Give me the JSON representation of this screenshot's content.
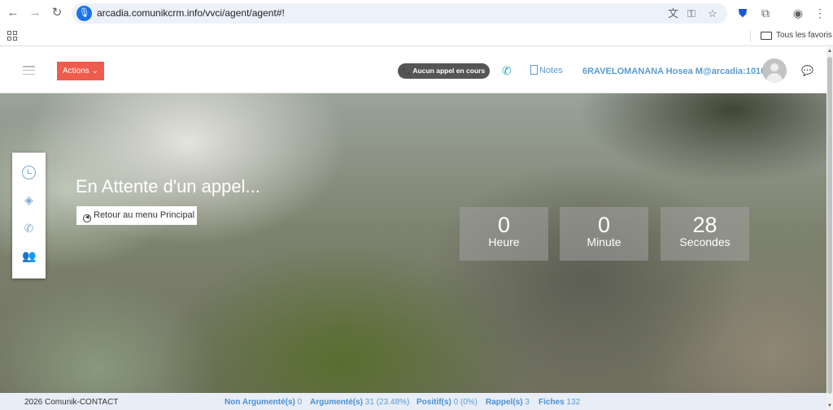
{
  "browser": {
    "url": "arcadia.comunikcrm.info/vvci/agent/agent#!",
    "bookmark_folder": "Tous les favoris"
  },
  "appbar": {
    "actions_label": "Actions ⌄",
    "call_status": "📞 Aucun appel en cours",
    "notes_label": "Notes",
    "agent_name": "6RAVELOMANANA Hosea M@arcadia:1010"
  },
  "main": {
    "waiting_title": "En Attente d'un appel...",
    "back_button": "Retour au menu Principal",
    "timers": [
      {
        "value": "0",
        "label": "Heure"
      },
      {
        "value": "0",
        "label": "Minute"
      },
      {
        "value": "28",
        "label": "Secondes"
      }
    ]
  },
  "footer": {
    "copyright": "2026 Comunik-CONTACT",
    "stats": [
      {
        "label": "Non Argumenté(s)",
        "value": "0"
      },
      {
        "label": "Argumenté(s)",
        "value": "31 (23.48%)"
      },
      {
        "label": "Positif(s)",
        "value": "0 (0%)"
      },
      {
        "label": "Rappel(s)",
        "value": "3"
      },
      {
        "label": "Fiches",
        "value": "132"
      }
    ]
  },
  "icons": [
    "back-arrow-icon",
    "forward-arrow-icon",
    "reload-icon",
    "mic-icon",
    "translate-icon",
    "key-icon",
    "star-icon",
    "shield-icon",
    "extensions-icon",
    "profile-icon",
    "menu-icon",
    "apps-icon",
    "folder-icon",
    "hamburger-icon",
    "phone-icon",
    "notes-icon",
    "avatar",
    "chat-icon",
    "clock-icon",
    "layers-icon",
    "incoming-call-icon",
    "users-icon"
  ],
  "colors": {
    "accent_red": "#ef5b4c",
    "link_blue": "#5b9bd1",
    "teal": "#26a5b7"
  }
}
